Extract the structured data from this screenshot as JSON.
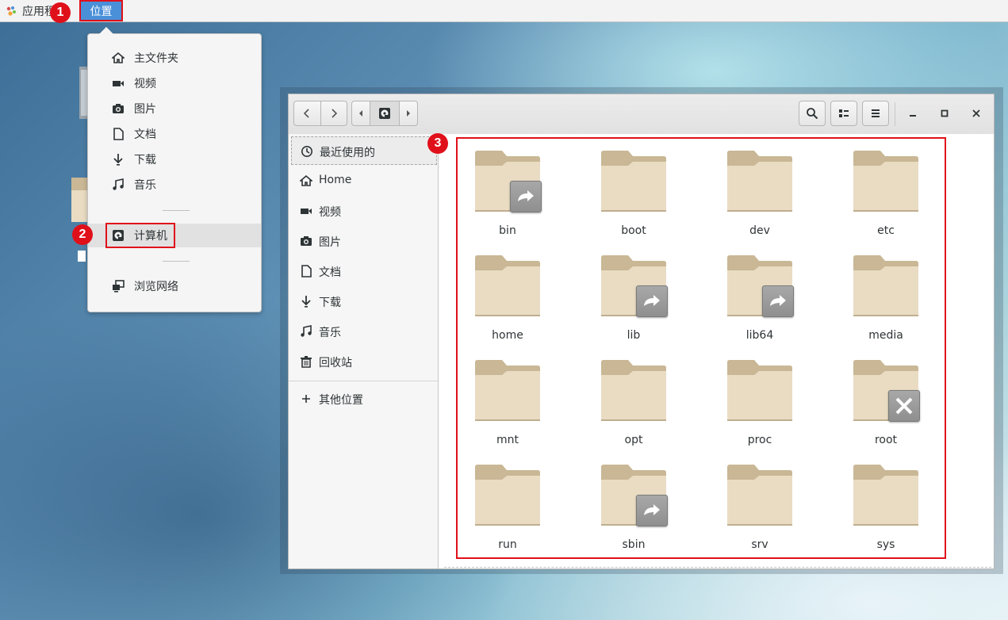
{
  "topbar": {
    "apps_label": "应用程序",
    "places_label": "位置"
  },
  "badges": [
    "1",
    "2",
    "3"
  ],
  "places_menu": {
    "items": [
      {
        "label": "主文件夹",
        "icon": "home-icon"
      },
      {
        "label": "视频",
        "icon": "video-icon"
      },
      {
        "label": "图片",
        "icon": "camera-icon"
      },
      {
        "label": "文档",
        "icon": "document-icon"
      },
      {
        "label": "下载",
        "icon": "download-icon"
      },
      {
        "label": "音乐",
        "icon": "music-icon"
      }
    ],
    "computer": {
      "label": "计算机",
      "icon": "computer-icon"
    },
    "network": {
      "label": "浏览网络",
      "icon": "network-icon"
    }
  },
  "sidebar": {
    "items": [
      {
        "label": "最近使用的",
        "icon": "recent-icon"
      },
      {
        "label": "Home",
        "icon": "home-icon"
      },
      {
        "label": "视频",
        "icon": "video-icon"
      },
      {
        "label": "图片",
        "icon": "camera-icon"
      },
      {
        "label": "文档",
        "icon": "document-icon"
      },
      {
        "label": "下载",
        "icon": "download-icon"
      },
      {
        "label": "音乐",
        "icon": "music-icon"
      },
      {
        "label": "回收站",
        "icon": "trash-icon"
      }
    ],
    "other_locations": {
      "label": "其他位置",
      "icon": "plus-icon"
    }
  },
  "folders": [
    {
      "name": "bin",
      "emblem": "symlink"
    },
    {
      "name": "boot",
      "emblem": ""
    },
    {
      "name": "dev",
      "emblem": ""
    },
    {
      "name": "etc",
      "emblem": ""
    },
    {
      "name": "home",
      "emblem": ""
    },
    {
      "name": "lib",
      "emblem": "symlink"
    },
    {
      "name": "lib64",
      "emblem": "symlink"
    },
    {
      "name": "media",
      "emblem": ""
    },
    {
      "name": "mnt",
      "emblem": ""
    },
    {
      "name": "opt",
      "emblem": ""
    },
    {
      "name": "proc",
      "emblem": ""
    },
    {
      "name": "root",
      "emblem": "no-access"
    },
    {
      "name": "run",
      "emblem": ""
    },
    {
      "name": "sbin",
      "emblem": "symlink"
    },
    {
      "name": "srv",
      "emblem": ""
    },
    {
      "name": "sys",
      "emblem": ""
    }
  ],
  "colors": {
    "highlight": "#4a90d9",
    "annotation_red": "#e0101a",
    "folder_tab": "#c9b795",
    "folder_body": "#e9dcc3"
  }
}
